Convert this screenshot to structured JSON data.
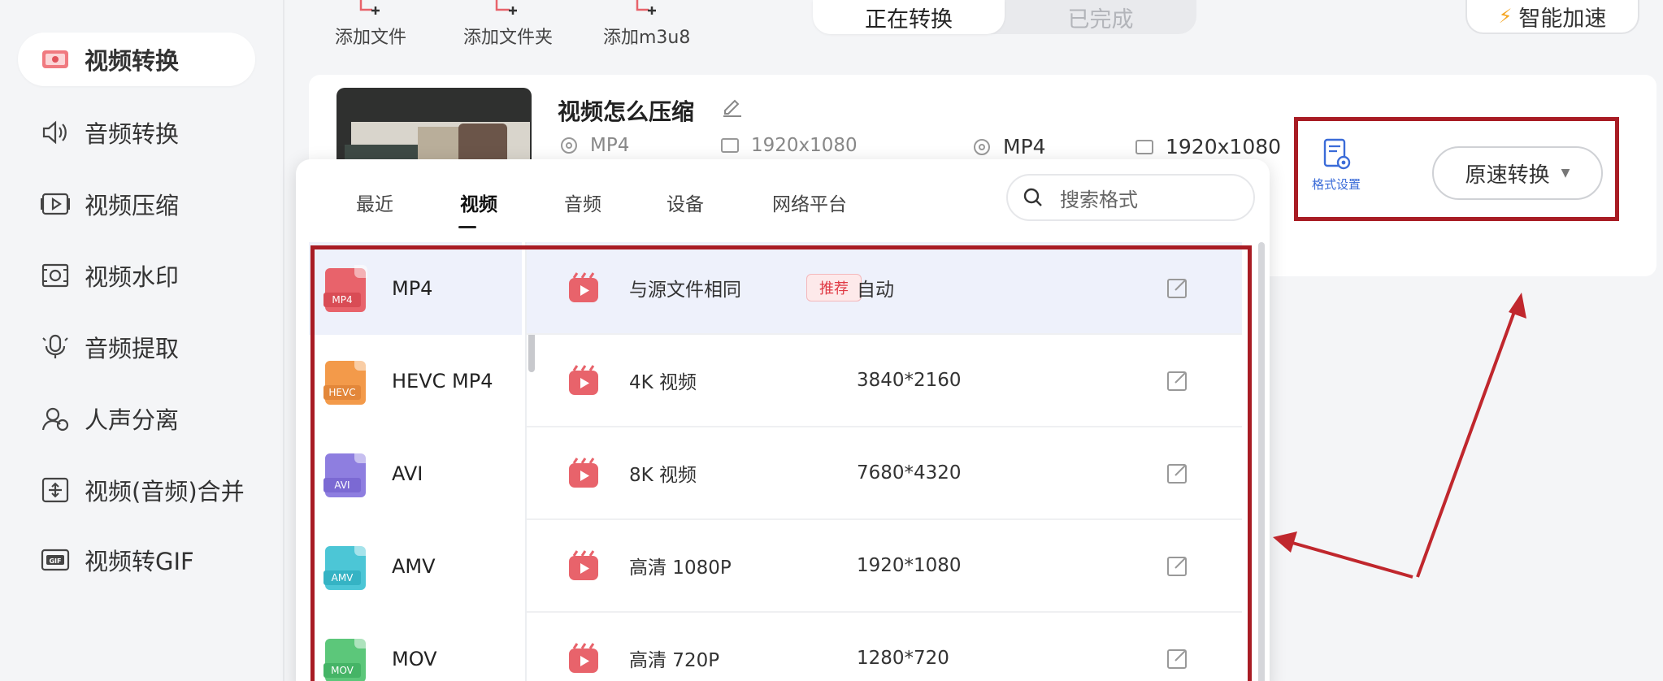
{
  "sidebar": {
    "items": [
      {
        "label": "视频转换",
        "icon": "video-convert-icon",
        "active": true
      },
      {
        "label": "音频转换",
        "icon": "audio-convert-icon"
      },
      {
        "label": "视频压缩",
        "icon": "video-compress-icon"
      },
      {
        "label": "视频水印",
        "icon": "video-watermark-icon"
      },
      {
        "label": "音频提取",
        "icon": "audio-extract-icon"
      },
      {
        "label": "人声分离",
        "icon": "voice-separate-icon"
      },
      {
        "label": "视频(音频)合并",
        "icon": "merge-icon"
      },
      {
        "label": "视频转GIF",
        "icon": "gif-icon"
      }
    ]
  },
  "toolbar": {
    "add_file": "添加文件",
    "add_folder": "添加文件夹",
    "add_m3u8": "添加m3u8"
  },
  "status_tabs": {
    "converting": "正在转换",
    "completed": "已完成"
  },
  "accelerate": "智能加速",
  "file": {
    "title": "视频怎么压缩",
    "src_format": "MP4",
    "src_resolution": "1920x1080",
    "dst_format": "MP4",
    "dst_resolution": "1920x1080"
  },
  "format_settings_label": "格式设置",
  "convert_button": "原速转换",
  "popup": {
    "tabs": [
      "最近",
      "视频",
      "音频",
      "设备",
      "网络平台"
    ],
    "active_tab": "视频",
    "search_placeholder": "搜索格式",
    "formats": [
      {
        "label": "MP4",
        "tag": "MP4",
        "color": "#e8636b"
      },
      {
        "label": "HEVC MP4",
        "tag": "HEVC",
        "color": "#f39a4a"
      },
      {
        "label": "AVI",
        "tag": "AVI",
        "color": "#8e7ee0"
      },
      {
        "label": "AMV",
        "tag": "AMV",
        "color": "#4cc6d6"
      },
      {
        "label": "MOV",
        "tag": "MOV",
        "color": "#5cc77a"
      }
    ],
    "presets": [
      {
        "name": "与源文件相同",
        "badge": "推荐",
        "resolution": "自动"
      },
      {
        "name": "4K 视频",
        "resolution": "3840*2160"
      },
      {
        "name": "8K 视频",
        "resolution": "7680*4320"
      },
      {
        "name": "高清 1080P",
        "resolution": "1920*1080"
      },
      {
        "name": "高清 720P",
        "resolution": "1280*720"
      }
    ]
  },
  "colors": {
    "accent_red": "#e8636b",
    "annotation_red": "#a81c24",
    "link_blue": "#3a6bd8"
  }
}
